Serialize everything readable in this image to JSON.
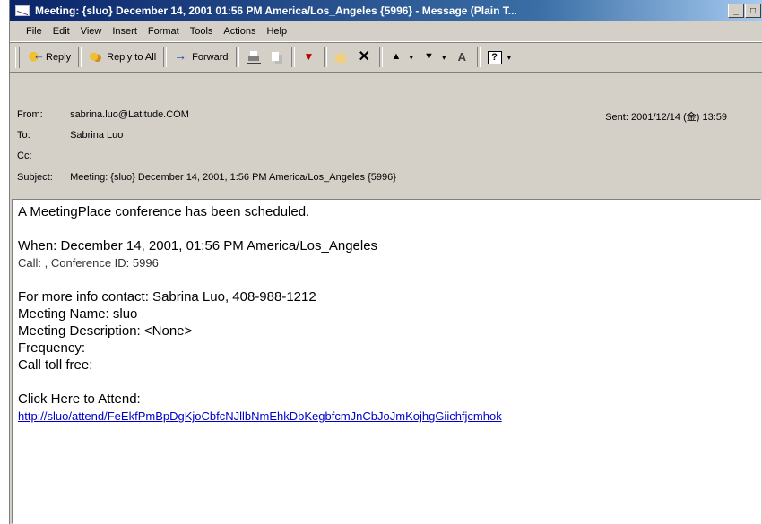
{
  "window": {
    "title": "Meeting: {sluo} December 14, 2001 01:56 PM America/Los_Angeles {5996} - Message (Plain T...",
    "buttons": [
      "_",
      "□"
    ]
  },
  "menu": [
    "File",
    "Edit",
    "View",
    "Insert",
    "Format",
    "Tools",
    "Actions",
    "Help"
  ],
  "toolbar": {
    "reply": "Reply",
    "reply_all": "Reply to All",
    "forward": "Forward",
    "help_icon": "?"
  },
  "header": {
    "from_label": "From:",
    "from_value": "sabrina.luo@Latitude.COM",
    "to_label": "To:",
    "to_value": "Sabrina Luo",
    "cc_label": "Cc:",
    "cc_value": "",
    "subject_label": "Subject:",
    "subject_value": "Meeting: {sluo} December 14, 2001, 1:56 PM America/Los_Angeles {5996}",
    "sent_label": "Sent:",
    "sent_value": "2001/12/14 (金) 13:59"
  },
  "body": {
    "line1": "A MeetingPlace conference has been scheduled.",
    "when": "When: December 14, 2001, 01:56 PM America/Los_Angeles",
    "call": "Call: , Conference ID: 5996",
    "contact": "For more info contact: Sabrina Luo,  408-988-1212",
    "meeting_name": "Meeting Name: sluo",
    "meeting_description": "Meeting Description: <None>",
    "frequency": "Frequency:",
    "toll_free": "Call toll free:",
    "click_here": "Click Here to Attend:",
    "url": "http://sluo/attend/FeEkfPmBpDgKjoCbfcNJllbNmEhkDbKegbfcmJnCbJoJmKojhgGiichfjcmhok"
  },
  "colors": {
    "titlebar_start": "#0a246a",
    "titlebar_end": "#a6caf0",
    "chrome": "#d4d0c8",
    "link": "#0000cc"
  }
}
